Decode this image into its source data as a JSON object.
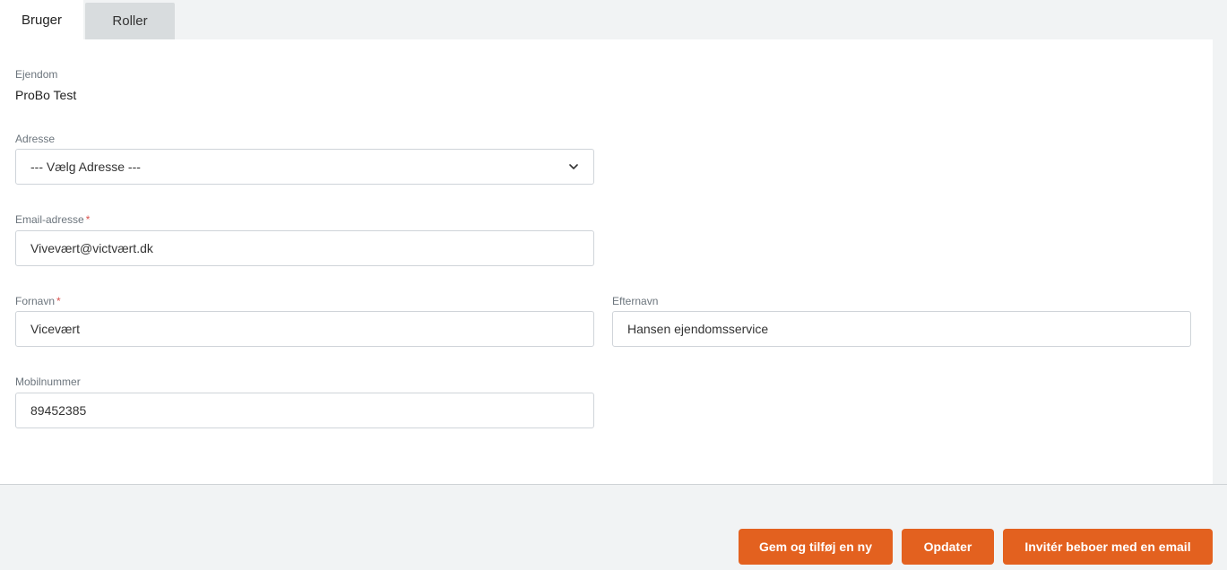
{
  "tabs": [
    {
      "label": "Bruger",
      "active": true
    },
    {
      "label": "Roller",
      "active": false
    }
  ],
  "form": {
    "property": {
      "label": "Ejendom",
      "value": "ProBo Test"
    },
    "address": {
      "label": "Adresse",
      "selected": "--- Vælg Adresse ---"
    },
    "email": {
      "label": "Email-adresse",
      "required_mark": "*",
      "value": "Vivevært@victvært.dk"
    },
    "first_name": {
      "label": "Fornavn",
      "required_mark": "*",
      "value": "Vicevært"
    },
    "last_name": {
      "label": "Efternavn",
      "value": "Hansen ejendomsservice"
    },
    "mobile": {
      "label": "Mobilnummer",
      "value": "89452385"
    }
  },
  "actions": {
    "save_add_new": "Gem og tilføj en ny",
    "update": "Opdater",
    "invite_email": "Invitér beboer med en email"
  },
  "colors": {
    "accent": "#e3611f",
    "required": "#d9534f",
    "background": "#f1f3f4",
    "panel": "#ffffff"
  },
  "icons": {
    "address_dropdown": "chevron-down-icon"
  }
}
